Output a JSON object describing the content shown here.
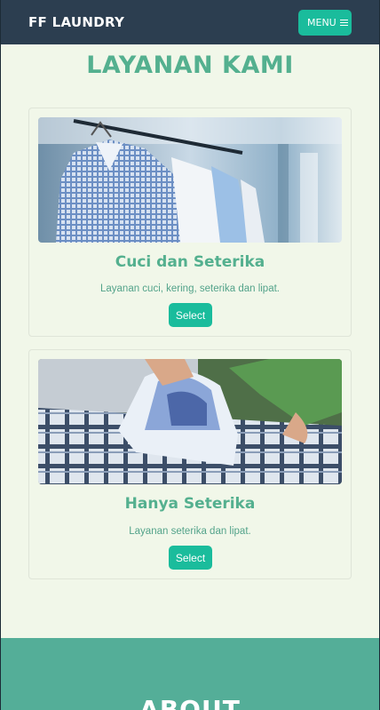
{
  "navbar": {
    "brand": "FF LAUNDRY",
    "menu_label": "MENU",
    "menu_icon": "hamburger-icon"
  },
  "services": {
    "title": "LAYANAN KAMI",
    "cards": [
      {
        "image": "shirts-on-hangers-photo",
        "title": "Cuci dan Seterika",
        "description": "Layanan cuci, kering, seterika dan lipat.",
        "button": "Select"
      },
      {
        "image": "ironing-shirt-photo",
        "title": "Hanya Seterika",
        "description": "Layanan seterika dan lipat.",
        "button": "Select"
      }
    ]
  },
  "about": {
    "title": "ABOUT"
  },
  "colors": {
    "navbar": "#2c3e50",
    "accent": "#1abc9c",
    "heading": "#54b08f",
    "background": "#f1f7e9",
    "about_bg": "#54ae98"
  }
}
